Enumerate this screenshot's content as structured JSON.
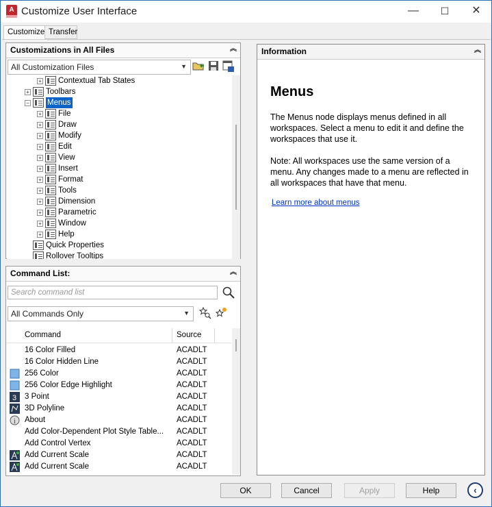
{
  "window": {
    "title": "Customize User Interface",
    "app_icon_letter": "A",
    "controls": {
      "minimize": "—",
      "maximize": "☐",
      "close": "✕"
    }
  },
  "tabs": [
    {
      "label": "Customize",
      "active": true
    },
    {
      "label": "Transfer",
      "active": false
    }
  ],
  "customizations": {
    "header": "Customizations in All Files",
    "filter_value": "All Customization Files",
    "tree": [
      {
        "label": "Contextual Tab States",
        "level": 2,
        "expander": "+"
      },
      {
        "label": "Toolbars",
        "level": 1,
        "expander": "+"
      },
      {
        "label": "Menus",
        "level": 1,
        "expander": "−",
        "selected": true
      },
      {
        "label": "File",
        "level": 2,
        "expander": "+"
      },
      {
        "label": "Draw",
        "level": 2,
        "expander": "+"
      },
      {
        "label": "Modify",
        "level": 2,
        "expander": "+"
      },
      {
        "label": "Edit",
        "level": 2,
        "expander": "+"
      },
      {
        "label": "View",
        "level": 2,
        "expander": "+"
      },
      {
        "label": "Insert",
        "level": 2,
        "expander": "+"
      },
      {
        "label": "Format",
        "level": 2,
        "expander": "+"
      },
      {
        "label": "Tools",
        "level": 2,
        "expander": "+"
      },
      {
        "label": "Dimension",
        "level": 2,
        "expander": "+"
      },
      {
        "label": "Parametric",
        "level": 2,
        "expander": "+"
      },
      {
        "label": "Window",
        "level": 2,
        "expander": "+"
      },
      {
        "label": "Help",
        "level": 2,
        "expander": "+"
      },
      {
        "label": "Quick Properties",
        "level": 1,
        "expander": ""
      },
      {
        "label": "Rollover Tooltips",
        "level": 1,
        "expander": ""
      }
    ]
  },
  "command_list": {
    "header": "Command List:",
    "search_placeholder": "Search command list",
    "filter_value": "All Commands Only",
    "columns": {
      "command": "Command",
      "source": "Source"
    },
    "rows": [
      {
        "command": "16 Color Filled",
        "source": "ACADLT",
        "icon": "none"
      },
      {
        "command": "16 Color Hidden Line",
        "source": "ACADLT",
        "icon": "none"
      },
      {
        "command": "256 Color",
        "source": "ACADLT",
        "icon": "blue-square-icon"
      },
      {
        "command": "256 Color Edge Highlight",
        "source": "ACADLT",
        "icon": "blue-square-icon"
      },
      {
        "command": "3 Point",
        "source": "ACADLT",
        "icon": "three-point-icon"
      },
      {
        "command": "3D Polyline",
        "source": "ACADLT",
        "icon": "polyline-icon"
      },
      {
        "command": "About",
        "source": "ACADLT",
        "icon": "info-icon"
      },
      {
        "command": "Add Color-Dependent Plot Style Table...",
        "source": "ACADLT",
        "icon": "none"
      },
      {
        "command": "Add Control Vertex",
        "source": "ACADLT",
        "icon": "none"
      },
      {
        "command": "Add Current Scale",
        "source": "ACADLT",
        "icon": "scale-icon"
      },
      {
        "command": "Add Current Scale",
        "source": "ACADLT",
        "icon": "scale-icon"
      }
    ]
  },
  "information": {
    "header": "Information",
    "title": "Menus",
    "para1": "The Menus node displays menus defined in all workspaces. Select a menu to edit it and define the workspaces that use it.",
    "para2": "Note: All workspaces use the same version of a menu. Any changes made to a menu are reflected in all workspaces that have that menu.",
    "link": "Learn more about menus"
  },
  "buttons": {
    "ok": "OK",
    "cancel": "Cancel",
    "apply": "Apply",
    "help": "Help",
    "nav": "‹"
  }
}
